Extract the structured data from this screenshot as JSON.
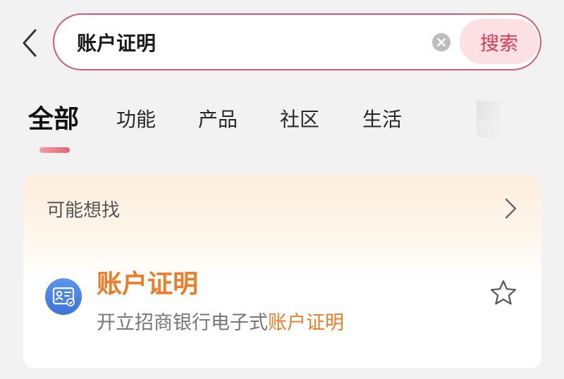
{
  "search": {
    "query": "账户证明",
    "button_label": "搜索"
  },
  "tabs": [
    {
      "label": "全部",
      "active": true
    },
    {
      "label": "功能",
      "active": false
    },
    {
      "label": "产品",
      "active": false
    },
    {
      "label": "社区",
      "active": false
    },
    {
      "label": "生活",
      "active": false
    }
  ],
  "suggestion_card": {
    "title": "可能想找",
    "item": {
      "title": "账户证明",
      "description_prefix": "开立招商银行电子式",
      "description_highlight": "账户证明",
      "icon": "certificate-icon"
    }
  },
  "colors": {
    "accent_red": "#d9394f",
    "highlight_orange": "#ef7b26",
    "icon_blue": "#4a86e8"
  }
}
